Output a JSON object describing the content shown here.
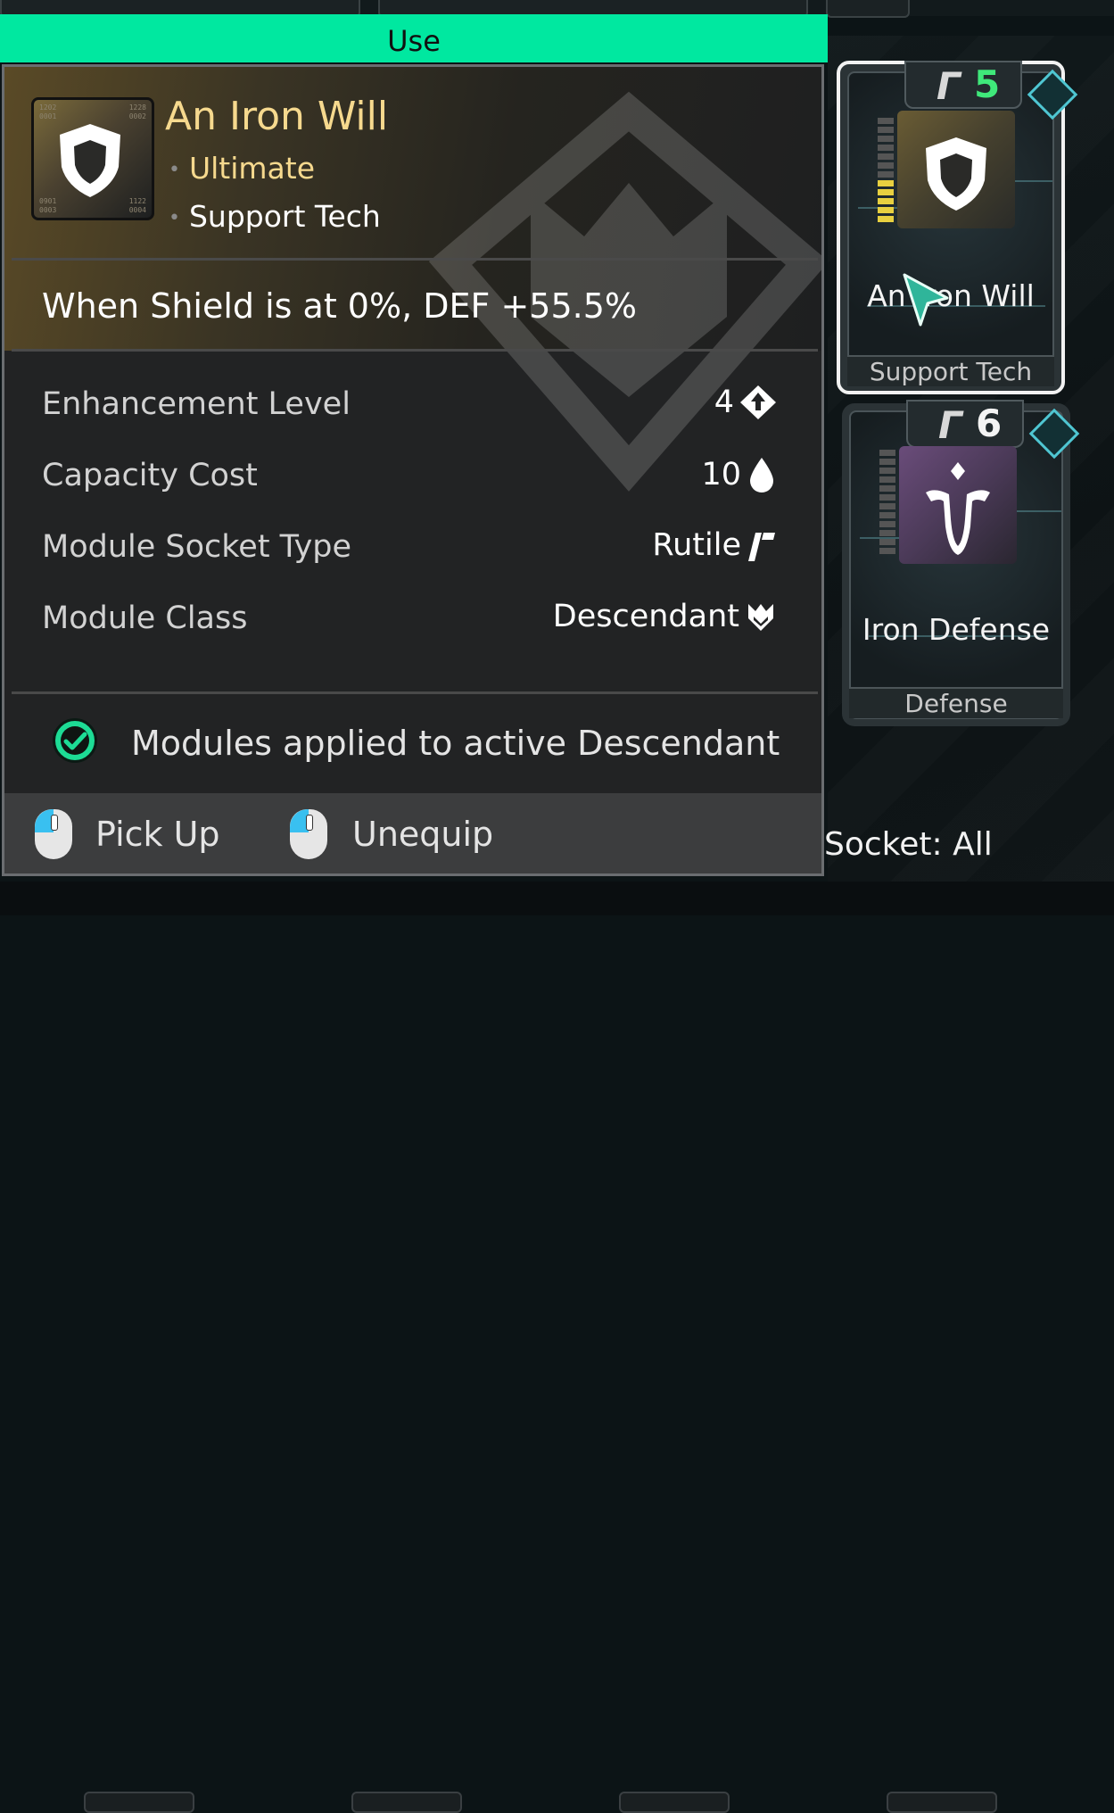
{
  "use_bar": {
    "label": "Use"
  },
  "tooltip": {
    "title": "An Iron Will",
    "tags": [
      "Ultimate",
      "Support Tech"
    ],
    "effect": "When Shield is at 0%, DEF +55.5%",
    "stats": [
      {
        "label": "Enhancement Level",
        "value": "4",
        "icon": "enhancement-icon"
      },
      {
        "label": "Capacity Cost",
        "value": "10",
        "icon": "capacity-drop-icon"
      },
      {
        "label": "Module Socket Type",
        "value": "Rutile",
        "icon": "rutile-socket-icon"
      },
      {
        "label": "Module Class",
        "value": "Descendant",
        "icon": "descendant-class-icon"
      }
    ],
    "notice": "Modules applied to active Descendant",
    "actions": [
      {
        "label": "Pick Up",
        "icon": "left-mouse-icon"
      },
      {
        "label": "Unequip",
        "icon": "left-mouse-icon"
      }
    ],
    "icon_numbers": [
      "1202",
      "1228",
      "0001",
      "0002",
      "0901",
      "1122",
      "0003",
      "0004"
    ]
  },
  "cards": [
    {
      "name": "An Iron Will",
      "type": "Support Tech",
      "socket_cost": "5",
      "cost_color": "#3fe87a",
      "selected": true,
      "level_filled": 5,
      "level_total": 12
    },
    {
      "name": "Iron Defense",
      "type": "Defense",
      "socket_cost": "6",
      "cost_color": "#f4f4f4",
      "selected": false,
      "level_filled": 0,
      "level_total": 12
    }
  ],
  "socket_filter": "Socket: All",
  "colors": {
    "accent": "#00e8a0",
    "gold": "#f6d98e",
    "panel": "#222324"
  }
}
